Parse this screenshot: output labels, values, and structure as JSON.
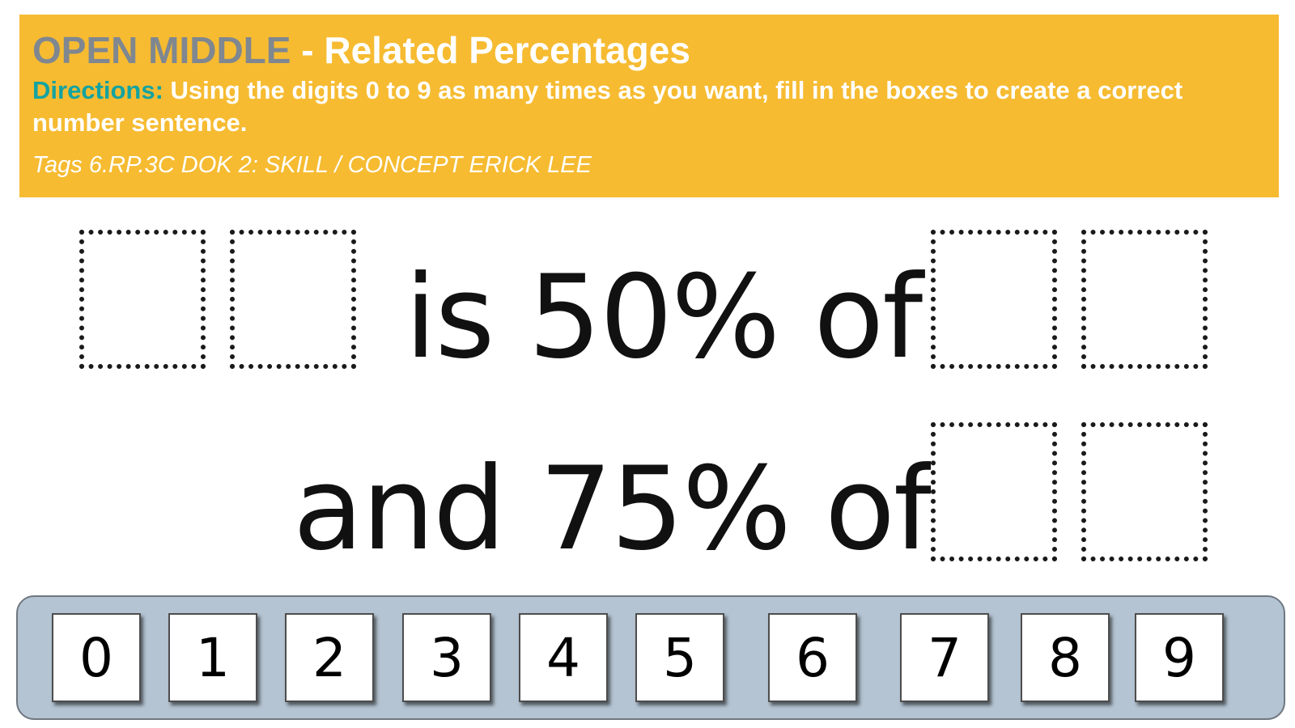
{
  "header": {
    "brand": "OPEN MIDDLE",
    "separator": "-",
    "title": "Related Percentages",
    "directions_label": "Directions:",
    "directions_text": "Using the digits 0 to 9 as many times as you want, fill in the boxes to create a correct number sentence.",
    "tags": "Tags 6.RP.3C DOK 2: SKILL / CONCEPT ERICK LEE"
  },
  "sentence": {
    "line1_text": "is 50% of",
    "line2_text": "and 75% of"
  },
  "tray": {
    "digits": [
      "0",
      "1",
      "2",
      "3",
      "4",
      "5",
      "6",
      "7",
      "8",
      "9"
    ]
  },
  "colors": {
    "banner": "#f6bb31",
    "brand": "#7f8790",
    "directions_label": "#14a3a0",
    "tray": "#b4c4d2"
  }
}
